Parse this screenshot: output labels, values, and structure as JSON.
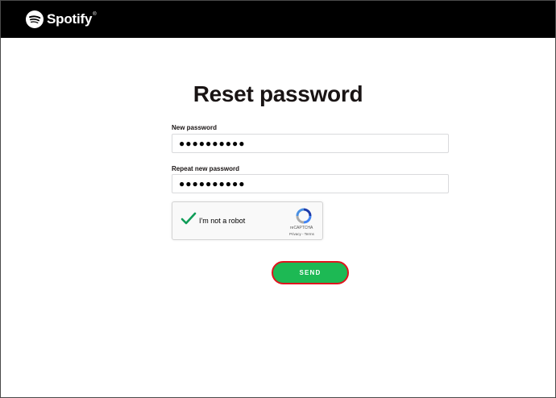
{
  "brand": {
    "name": "Spotify",
    "tm": "®",
    "icon": "spotify-logo-icon"
  },
  "colors": {
    "topbar": "#000000",
    "accent_green": "#1db954",
    "highlight_red": "#e0141e"
  },
  "page": {
    "title": "Reset password"
  },
  "form": {
    "new_password_label": "New password",
    "new_password_value": "●●●●●●●●●●",
    "repeat_password_label": "Repeat new password",
    "repeat_password_value": "●●●●●●●●●●"
  },
  "captcha": {
    "label": "I'm not a robot",
    "brand": "reCAPTCHA",
    "links": "Privacy - Terms",
    "checked": true
  },
  "actions": {
    "send_label": "SEND"
  }
}
